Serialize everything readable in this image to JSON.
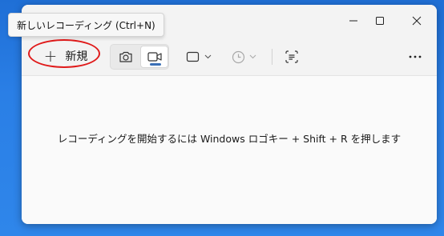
{
  "tooltip": {
    "text": "新しいレコーディング (Ctrl+N)"
  },
  "toolbar": {
    "new_button": {
      "icon": "plus-icon",
      "label": "新規"
    },
    "modes": [
      {
        "name": "screenshot",
        "icon": "camera-icon",
        "selected": false
      },
      {
        "name": "video",
        "icon": "video-camera-icon",
        "selected": true
      }
    ],
    "area_dropdown": {
      "icon": "rectangle-select-icon"
    },
    "delay_dropdown": {
      "icon": "clock-icon",
      "disabled": true
    },
    "text_action": {
      "icon": "text-scan-icon"
    },
    "more": {
      "icon": "more-icon"
    }
  },
  "window_controls": [
    "minimize-icon",
    "maximize-icon",
    "close-icon"
  ],
  "content": {
    "hint": "レコーディングを開始するには Windows ロゴキー + Shift + R を押します"
  },
  "colors": {
    "annotation": "#e01a1a",
    "accent": "#3a6fb6",
    "desktop": "#2a7fe6"
  }
}
